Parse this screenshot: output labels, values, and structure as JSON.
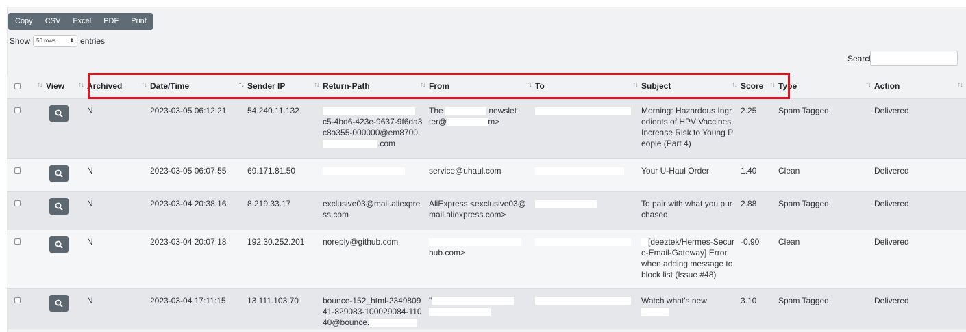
{
  "toolbar": {
    "buttons": [
      "Copy",
      "CSV",
      "Excel",
      "PDF",
      "Print"
    ]
  },
  "length": {
    "show_label": "Show",
    "selected": "50 rows",
    "caret": "⬍",
    "entries_label": "entries"
  },
  "search": {
    "label": "Search:",
    "value": ""
  },
  "table": {
    "headers": [
      "",
      "View",
      "Archived",
      "Date/Time",
      "Sender IP",
      "Return-Path",
      "From",
      "To",
      "Subject",
      "Score",
      "Type",
      "Action"
    ],
    "sort_glyph": "↑↓",
    "rows": [
      {
        "archived": "N",
        "datetime": "2023-03-05 06:12:21",
        "sender_ip": "54.240.11.132",
        "return_path": "c5-4bd6-423e-9637-9f6da3c8a355-000000@em8700.",
        "return_path_tail": ".com",
        "from_prefix": "The",
        "from_mid": "newslet",
        "from_line2": "ter@",
        "from_end": "m>",
        "subject": "Morning: Hazardous Ingredients of HPV Vaccines Increase Risk to Young People (Part 4)",
        "score": "2.25",
        "type": "Spam Tagged",
        "action": "Delivered"
      },
      {
        "archived": "N",
        "datetime": "2023-03-05 06:07:55",
        "sender_ip": "69.171.81.50",
        "return_path": "",
        "from": "service@uhaul.com",
        "subject": "Your U-Haul Order",
        "score": "1.40",
        "type": "Clean",
        "action": "Delivered"
      },
      {
        "archived": "N",
        "datetime": "2023-03-04 20:38:16",
        "sender_ip": "8.219.33.17",
        "return_path": "exclusive03@mail.aliexpress.com",
        "from": "AliExpress <exclusive03@mail.aliexpress.com>",
        "subject": "To pair with what you purchased",
        "score": "2.88",
        "type": "Spam Tagged",
        "action": "Delivered"
      },
      {
        "archived": "N",
        "datetime": "2023-03-04 20:07:18",
        "sender_ip": "192.30.252.201",
        "return_path": "noreply@github.com",
        "from": "hub.com>",
        "subject": "[deeztek/Hermes-Secure-Email-Gateway] Error when adding message to block list (Issue #48)",
        "score": "-0.90",
        "type": "Clean",
        "action": "Delivered"
      },
      {
        "archived": "N",
        "datetime": "2023-03-04 17:11:15",
        "sender_ip": "13.111.103.70",
        "return_path": "bounce-152_html-234980941-829083-100029084-11040@bounce.",
        "from": "\"",
        "subject": "Watch what's new",
        "score": "3.10",
        "type": "Spam Tagged",
        "action": "Delivered"
      }
    ]
  }
}
